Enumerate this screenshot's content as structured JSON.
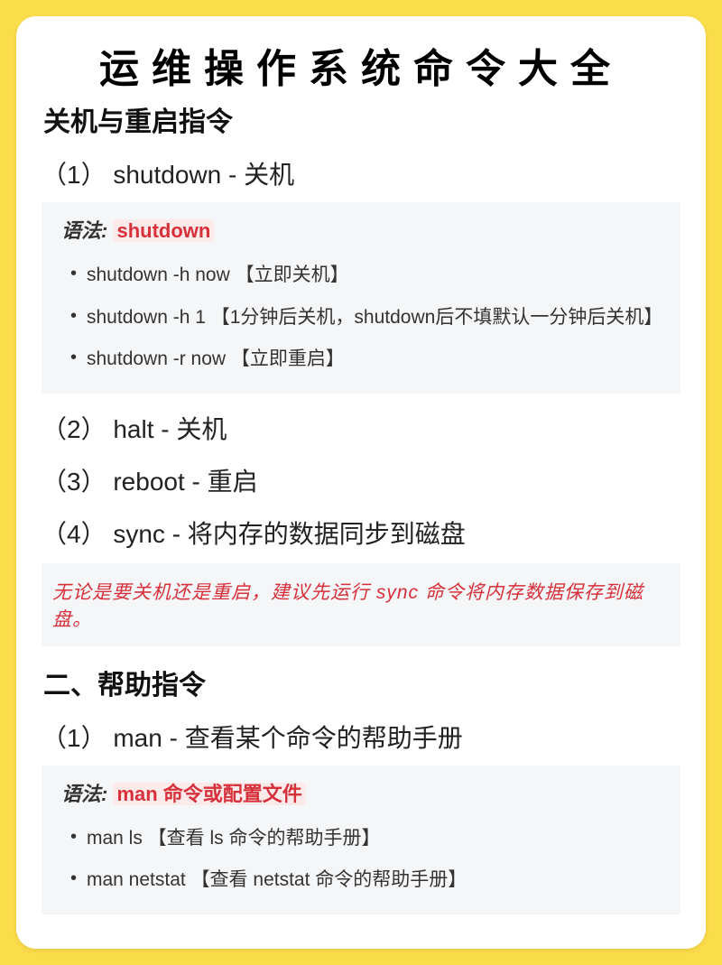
{
  "title": "运维操作系统命令大全",
  "section1": {
    "heading": "关机与重启指令",
    "items": [
      {
        "label": "（1） shutdown - 关机",
        "syntax_prefix": "语法: ",
        "syntax_cmd": "shutdown",
        "examples": [
          "shutdown -h now 【立即关机】",
          "shutdown -h 1 【1分钟后关机，shutdown后不填默认一分钟后关机】",
          "shutdown -r now 【立即重启】"
        ]
      },
      {
        "label": "（2） halt - 关机"
      },
      {
        "label": "（3） reboot - 重启"
      },
      {
        "label": "（4） sync - 将内存的数据同步到磁盘"
      }
    ],
    "note": "无论是要关机还是重启，建议先运行 sync 命令将内存数据保存到磁盘。"
  },
  "section2": {
    "heading": "二、帮助指令",
    "items": [
      {
        "label": "（1） man - 查看某个命令的帮助手册",
        "syntax_prefix": "语法: ",
        "syntax_cmd": "man 命令或配置文件",
        "examples": [
          "man ls 【查看 ls 命令的帮助手册】",
          "man netstat 【查看 netstat 命令的帮助手册】"
        ]
      }
    ]
  }
}
